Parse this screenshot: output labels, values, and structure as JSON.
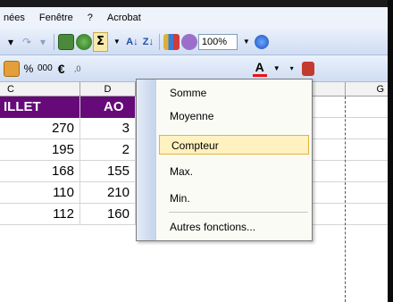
{
  "menu": [
    "nées",
    "Fenêtre",
    "?",
    "Acrobat"
  ],
  "toolbar1": {
    "zoom": "100%",
    "sigma": "Σ"
  },
  "toolbar2": {
    "percent": "%",
    "thousands": "000",
    "euro": "€",
    "font_color": "A"
  },
  "columns": [
    "C",
    "D",
    "G"
  ],
  "header_row": [
    "ILLET",
    "AO"
  ],
  "rows": [
    [
      "270",
      "3"
    ],
    [
      "195",
      "2"
    ],
    [
      "168",
      "155"
    ],
    [
      "110",
      "210"
    ],
    [
      "112",
      "160"
    ]
  ],
  "dropdown": {
    "items": [
      "Somme",
      "Moyenne",
      "Compteur",
      "Max.",
      "Min.",
      "Autres fonctions..."
    ],
    "highlighted": "Compteur"
  },
  "colors": {
    "header_purple": "#660a7a",
    "highlight": "#fff1c0"
  }
}
